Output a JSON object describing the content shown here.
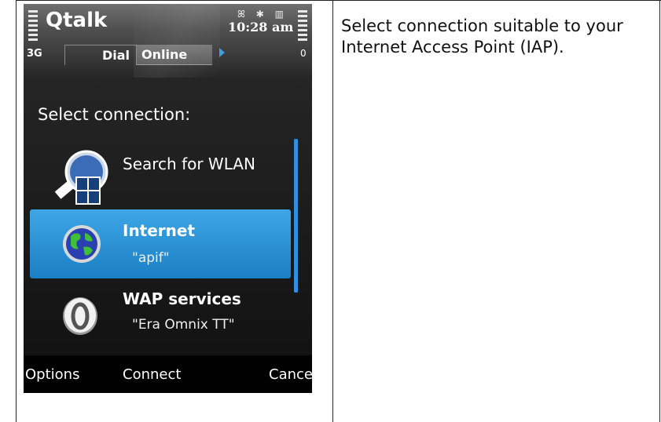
{
  "phone": {
    "app_title": "Qtalk",
    "status_icons": "ꕤ ✱ ▥",
    "clock": "10:28 am",
    "network": "3G",
    "tabs": [
      {
        "label": "Dial"
      },
      {
        "label": "Online"
      }
    ],
    "memory_indicator": "0",
    "heading": "Select connection:",
    "connections": [
      {
        "label": "Search for WLAN",
        "sub": "",
        "icon": "wlan-search-icon"
      },
      {
        "label": "Internet",
        "sub": "\"apif\"",
        "icon": "globe-icon",
        "selected": true
      },
      {
        "label": "WAP services",
        "sub": "\"Era Omnix TT\"",
        "icon": "wap-icon"
      }
    ],
    "softkeys": {
      "left": "Options",
      "middle": "Connect",
      "right": "Cancel"
    },
    "colors": {
      "selection": "#2f95d8",
      "scrollbar": "#2f8fe0",
      "background": "#101010"
    }
  },
  "description": "Select connection suitable to your Internet Access Point (IAP)."
}
